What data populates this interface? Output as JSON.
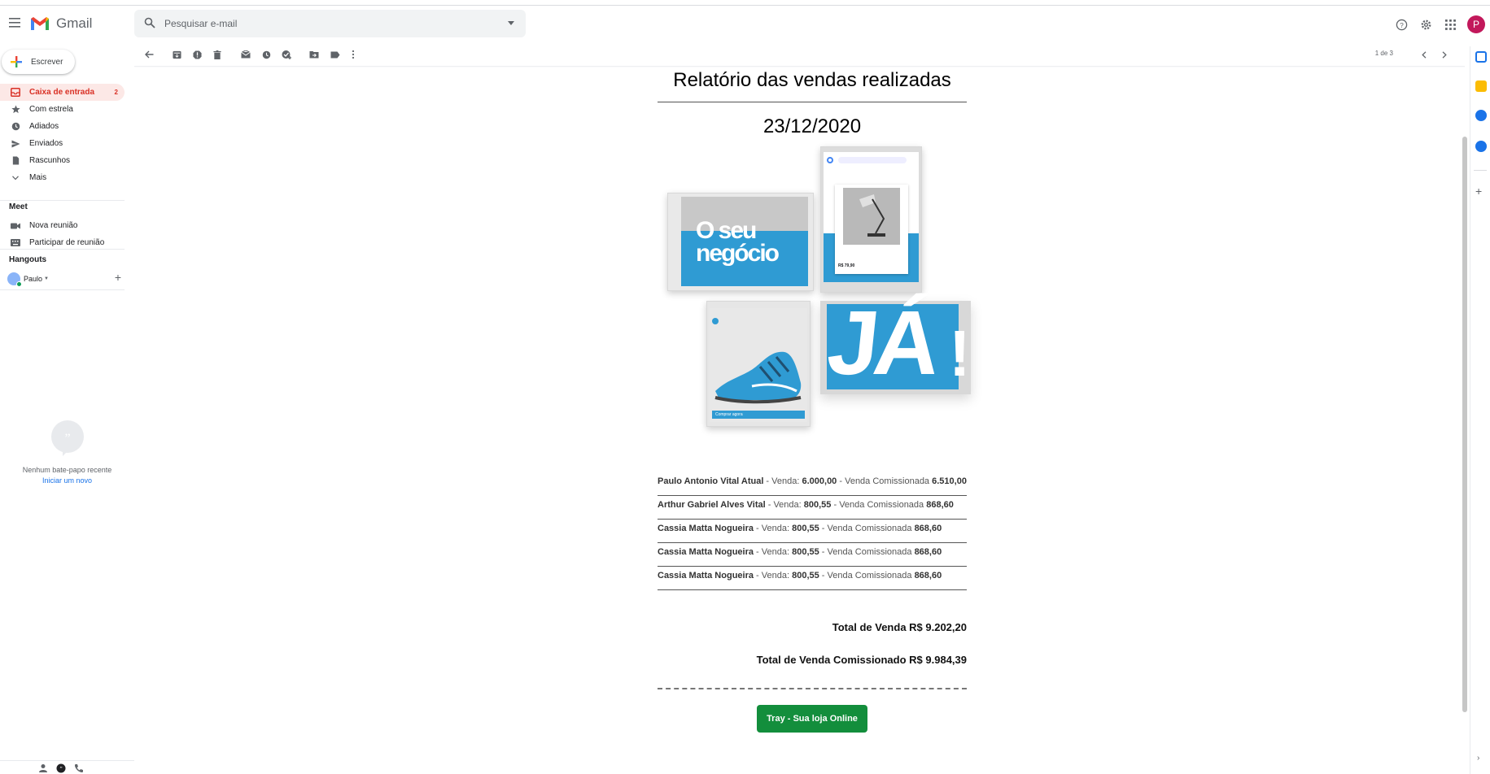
{
  "app": {
    "name": "Gmail",
    "search_placeholder": "Pesquisar e-mail",
    "avatar_initial": "P",
    "brand_red": "#d93025"
  },
  "sidebar": {
    "compose_label": "Escrever",
    "items": [
      {
        "label": "Caixa de entrada",
        "count": "2",
        "icon": "inbox-icon",
        "active": true
      },
      {
        "label": "Com estrela",
        "icon": "star-icon"
      },
      {
        "label": "Adiados",
        "icon": "clock-icon"
      },
      {
        "label": "Enviados",
        "icon": "send-icon"
      },
      {
        "label": "Rascunhos",
        "icon": "draft-icon"
      },
      {
        "label": "Mais",
        "icon": "chevron-down-icon"
      }
    ],
    "meet": {
      "title": "Meet",
      "items": [
        {
          "label": "Nova reunião",
          "icon": "video-icon"
        },
        {
          "label": "Participar de reunião",
          "icon": "keyboard-icon"
        }
      ]
    },
    "hangouts": {
      "title": "Hangouts",
      "user_name": "Paulo",
      "no_chat_text": "Nenhum bate-papo recente",
      "start_new_link": "Iniciar um novo"
    }
  },
  "toolbar": {
    "page_count": "1 de 3"
  },
  "email": {
    "title": "Relatório das vendas realizadas",
    "date": "23/12/2020",
    "hero": {
      "card1_text_line1": "O seu",
      "card1_text_line2": "negócio",
      "card_ja_text": "JÁ",
      "card_exclaim": "!",
      "shoe_buy_label": "Comprar agora",
      "lamp_price": "R$ 79,90"
    },
    "sales": [
      {
        "name": "Paulo Antonio Vital Atual",
        "venda_label": "Venda:",
        "venda": "6.000,00",
        "comissao_label": "Venda Comissionada",
        "comissao": "6.510,00"
      },
      {
        "name": "Arthur Gabriel Alves Vital",
        "venda_label": "Venda:",
        "venda": "800,55",
        "comissao_label": "Venda Comissionada",
        "comissao": "868,60"
      },
      {
        "name": "Cassia Matta Nogueira",
        "venda_label": "Venda:",
        "venda": "800,55",
        "comissao_label": "Venda Comissionada",
        "comissao": "868,60"
      },
      {
        "name": "Cassia Matta Nogueira",
        "venda_label": "Venda:",
        "venda": "800,55",
        "comissao_label": "Venda Comissionada",
        "comissao": "868,60"
      },
      {
        "name": "Cassia Matta Nogueira",
        "venda_label": "Venda:",
        "venda": "800,55",
        "comissao_label": "Venda Comissionada",
        "comissao": "868,60"
      }
    ],
    "total_venda": "Total de Venda R$ 9.202,20",
    "total_comissionado": "Total de Venda Comissionado R$ 9.984,39",
    "cta_label": "Tray - Sua loja Online",
    "cta_color": "#138e3c"
  }
}
